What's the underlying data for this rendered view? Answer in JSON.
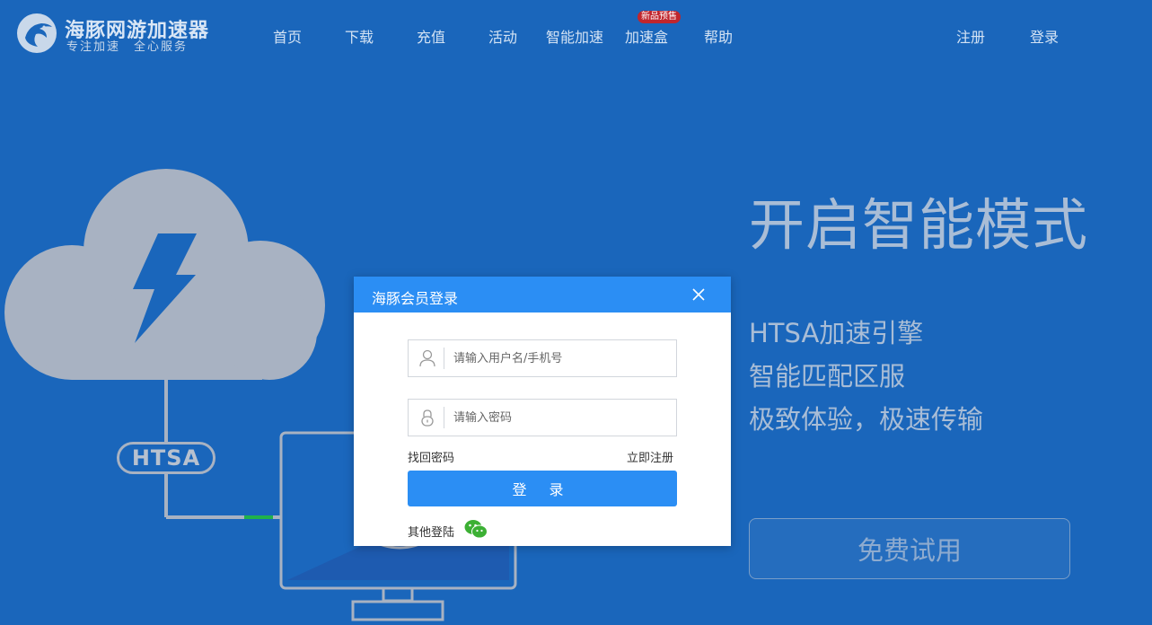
{
  "brand": {
    "name": "海豚网游加速器",
    "slogan": "专注加速　全心服务"
  },
  "nav": {
    "items": [
      "首页",
      "下载",
      "充值",
      "活动",
      "智能加速",
      "加速盒",
      "帮助"
    ],
    "badge": "新品预售",
    "register": "注册",
    "login": "登录"
  },
  "hero": {
    "title": "开启智能模式",
    "features": [
      "HTSA加速引擎",
      "智能匹配区服",
      "极致体验，极速传输"
    ],
    "trial_button": "免费试用",
    "htsa_label": "HTSA"
  },
  "modal": {
    "title": "海豚会员登录",
    "username_placeholder": "请输入用户名/手机号",
    "password_placeholder": "请输入密码",
    "forgot_password": "找回密码",
    "register_now": "立即注册",
    "login_button": "登 录",
    "other_login": "其他登陆"
  },
  "colors": {
    "background": "#1a66bb",
    "accent": "#2b8ef4",
    "badge": "#c0262d",
    "wechat": "#3cb034"
  },
  "icons": [
    "dolphin-logo-icon",
    "close-icon",
    "user-icon",
    "lock-icon",
    "wechat-icon",
    "cloud-icon",
    "lightning-icon",
    "monitor-icon"
  ]
}
